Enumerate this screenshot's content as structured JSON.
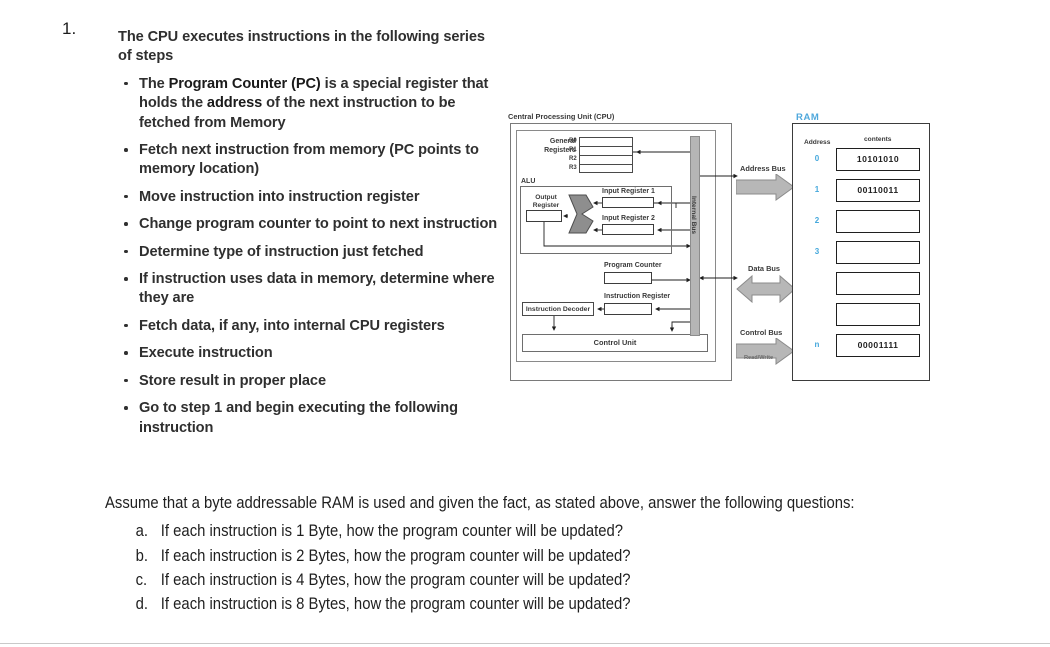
{
  "question_number": "1.",
  "slide": {
    "intro": "The CPU executes instructions in the following series of steps",
    "bullets": [
      {
        "parts": [
          {
            "t": "The ",
            "b": false
          },
          {
            "t": "Program Counter  (PC)",
            "b": true
          },
          {
            "t": " is a special register that holds the ",
            "b": false
          },
          {
            "t": "address",
            "b": true
          },
          {
            "t": " of the next instruction to be fetched from Memory",
            "b": false
          }
        ]
      },
      {
        "parts": [
          {
            "t": "Fetch next instruction from memory (PC points to memory location)",
            "b": false
          }
        ]
      },
      {
        "parts": [
          {
            "t": "Move instruction into instruction register",
            "b": false
          }
        ]
      },
      {
        "parts": [
          {
            "t": "Change program counter to point to next instruction",
            "b": false
          }
        ]
      },
      {
        "parts": [
          {
            "t": "Determine type of instruction just fetched",
            "b": false
          }
        ]
      },
      {
        "parts": [
          {
            "t": "If instruction uses data in memory, determine where they are",
            "b": false
          }
        ]
      },
      {
        "parts": [
          {
            "t": "Fetch data, if any, into internal CPU registers",
            "b": false
          }
        ]
      },
      {
        "parts": [
          {
            "t": "Execute instruction",
            "b": false
          }
        ]
      },
      {
        "parts": [
          {
            "t": "Store result in proper place",
            "b": false
          }
        ]
      },
      {
        "parts": [
          {
            "t": "Go to step 1 and begin executing the following instruction",
            "b": false
          }
        ]
      }
    ]
  },
  "diagram": {
    "cpu_title": "Central Processing Unit (CPU)",
    "ram_title": "RAM",
    "ram_title_color": "#4fa8dc",
    "general_registers_label": "General\nRegisters",
    "register_names": [
      "R0",
      "R1",
      "R2",
      "R3"
    ],
    "alu_label": "ALU",
    "output_register_label": "Output\nRegister",
    "input_register_1_label": "Input Register 1",
    "input_register_2_label": "Input Register 2",
    "program_counter_label": "Program Counter",
    "instruction_register_label": "Instruction Register",
    "instruction_decoder_label": "Instruction Decoder",
    "control_unit_label": "Control Unit",
    "internal_bus_label": "Internal Bus",
    "address_bus_label": "Address Bus",
    "data_bus_label": "Data Bus",
    "control_bus_label": "Control Bus",
    "read_write_label": "Read/Write",
    "ram_header_address": "Address",
    "ram_header_contents": "contents",
    "ram_cells": [
      {
        "address": "0",
        "contents": "10101010"
      },
      {
        "address": "1",
        "contents": "00110011"
      },
      {
        "address": "2",
        "contents": ""
      },
      {
        "address": "3",
        "contents": ""
      },
      {
        "address": "",
        "contents": ""
      },
      {
        "address": "",
        "contents": ""
      },
      {
        "address": "n",
        "contents": "00001111"
      }
    ]
  },
  "question": {
    "assume_text": "Assume that a byte addressable RAM is used and given the fact, as stated above, answer the following questions:",
    "sub_questions": [
      {
        "marker": "a.",
        "text": "If each instruction is 1 Byte, how the program counter will be updated?"
      },
      {
        "marker": "b.",
        "text": "If each instruction is 2 Bytes, how the program counter will be updated?"
      },
      {
        "marker": "c.",
        "text": "If each instruction is 4 Bytes, how the program counter will be updated?"
      },
      {
        "marker": "d.",
        "text": "If each instruction is 8 Bytes, how the program counter will be updated?"
      }
    ]
  }
}
